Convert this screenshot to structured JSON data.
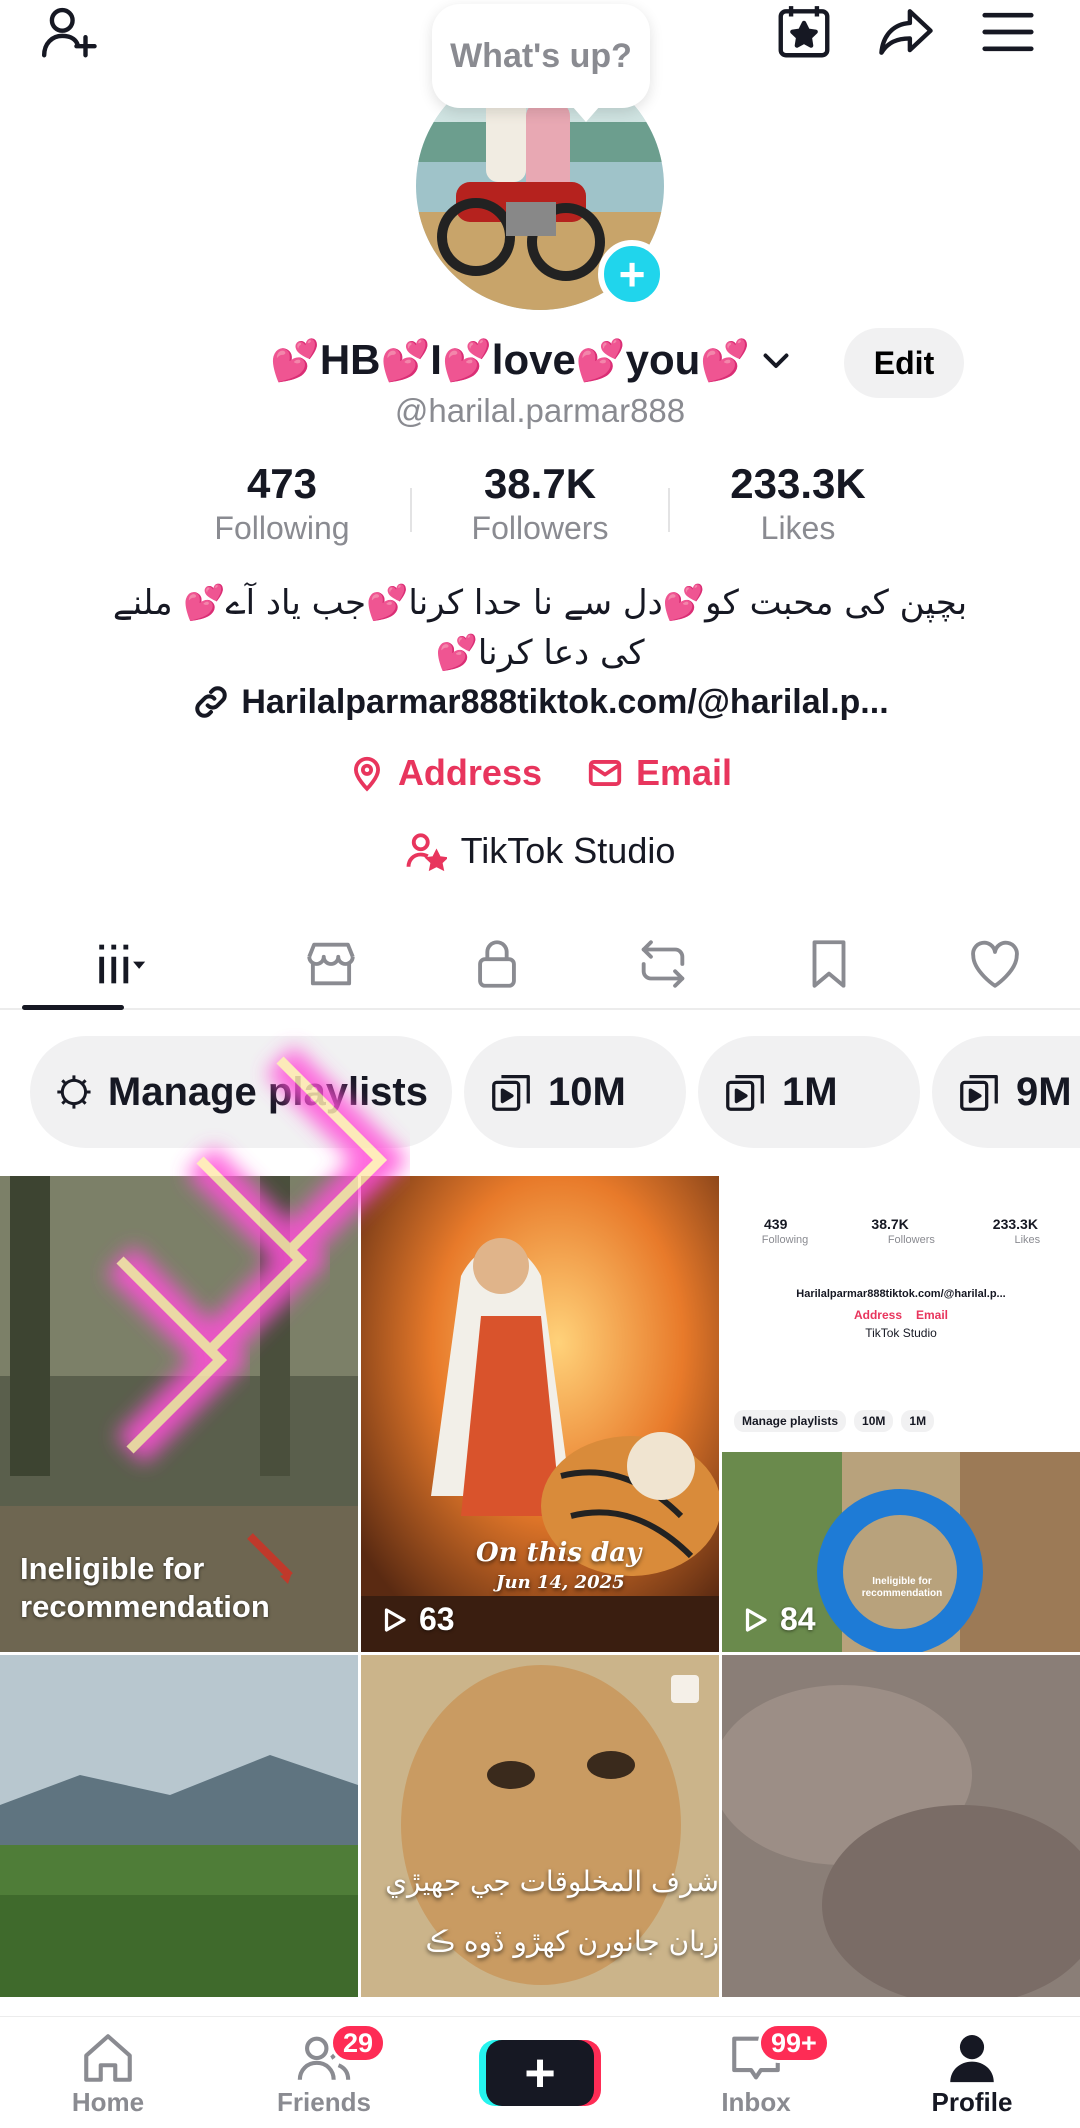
{
  "header": {
    "bubble_text": "What's up?"
  },
  "profile": {
    "name_parts": [
      "HB",
      "I",
      "love",
      "you"
    ],
    "heart_glyph": "💕",
    "edit_label": "Edit",
    "handle": "@harilal.parmar888",
    "stats": [
      {
        "value": "473",
        "label": "Following"
      },
      {
        "value": "38.7K",
        "label": "Followers"
      },
      {
        "value": "233.3K",
        "label": "Likes"
      }
    ],
    "bio_line1": "بچپن کی محبت کو💕دل سے نا حدا کرنا💕جب یاد آے💕 ملنے",
    "bio_line2": "کی دعا کرنا💕",
    "link": "Harilalparmar888tiktok.com/@harilal.p...",
    "address_label": "Address",
    "email_label": "Email",
    "studio_label": "TikTok Studio"
  },
  "tabs": [
    "videos-grid-icon",
    "shop-icon",
    "lock-icon",
    "repost-icon",
    "bookmark-icon",
    "heart-icon"
  ],
  "chips": [
    {
      "label": "Manage playlists",
      "icon": "gear-icon"
    },
    {
      "label": "10M",
      "icon": "playlist-icon"
    },
    {
      "label": "1M",
      "icon": "playlist-icon"
    },
    {
      "label": "9M",
      "icon": "playlist-icon"
    }
  ],
  "grid": [
    {
      "caption": "Ineligible for recommendation"
    },
    {
      "title": "On this day",
      "date": "Jun 14, 2025",
      "views": "63"
    },
    {
      "views": "84",
      "mini_stats": [
        "439",
        "38.7K",
        "233.3K"
      ],
      "mini_labels": [
        "Following",
        "Followers",
        "Likes"
      ],
      "mini_chips": [
        "Manage playlists",
        "10M",
        "1M"
      ],
      "mini_caption": "Ineligible for recommendation"
    },
    {},
    {
      "caption_line1": "شرف المخلوقات جي جهيڙي",
      "caption_line2": "زبان جانورن کهڙو ڏوه ڪ"
    },
    {}
  ],
  "nav": {
    "home": "Home",
    "friends": "Friends",
    "friends_badge": "29",
    "inbox": "Inbox",
    "inbox_badge": "99+",
    "profile": "Profile"
  },
  "colors": {
    "accent": "#fe2c55",
    "contact": "#e8355d",
    "cyan": "#20d5ec",
    "muted": "#8a8b91"
  }
}
